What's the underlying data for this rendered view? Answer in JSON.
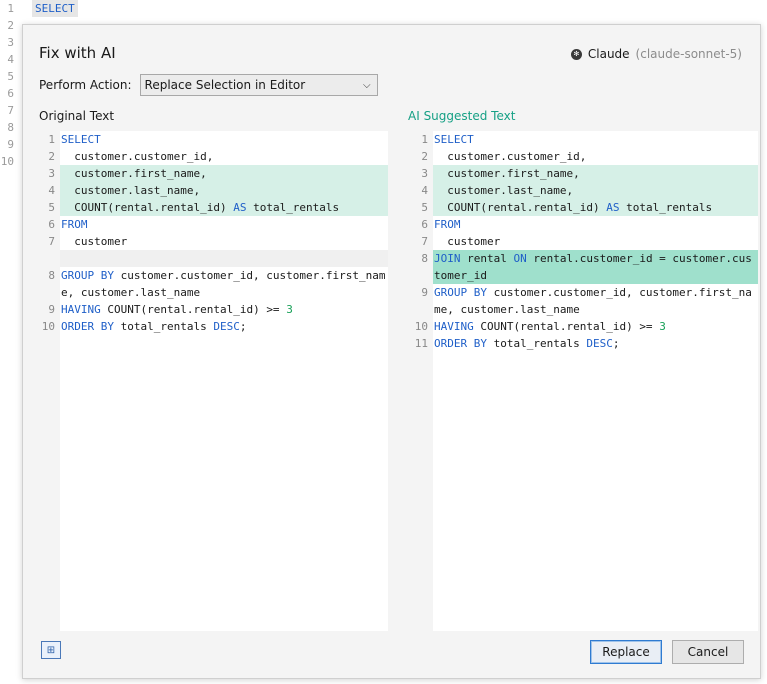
{
  "background_editor": {
    "line_numbers": [
      "1",
      "2",
      "3",
      "4",
      "5",
      "6",
      "7",
      "8",
      "9",
      "10"
    ],
    "first_line": "SELECT"
  },
  "dialog": {
    "title": "Fix with AI",
    "provider": {
      "icon": "claude-logo-icon",
      "name": "Claude",
      "model": "(claude-sonnet-5)"
    },
    "perform_action_label": "Perform Action:",
    "perform_action_value": "Replace Selection in Editor",
    "original_label": "Original Text",
    "ai_label": "AI Suggested Text",
    "replace_label": "Replace",
    "cancel_label": "Cancel",
    "toggle_icon": "diff-view-icon",
    "colors": {
      "highlight": "#d6f0e7",
      "highlight_strong": "#9fe0cc",
      "ai_label": "#16a085",
      "keyword": "#1f5fc8",
      "number": "#18a058"
    }
  },
  "original_lines": [
    {
      "n": "1",
      "hl": "",
      "tokens": [
        [
          "kw",
          "SELECT"
        ]
      ]
    },
    {
      "n": "2",
      "hl": "",
      "tokens": [
        [
          "",
          "  customer.customer_id,"
        ]
      ]
    },
    {
      "n": "3",
      "hl": "hl",
      "tokens": [
        [
          "",
          "  customer.first_name,"
        ]
      ]
    },
    {
      "n": "4",
      "hl": "hl",
      "tokens": [
        [
          "",
          "  customer.last_name,"
        ]
      ]
    },
    {
      "n": "5",
      "hl": "hl",
      "tokens": [
        [
          "",
          "  COUNT(rental.rental_id) "
        ],
        [
          "kw",
          "AS"
        ],
        [
          "",
          " total_rentals"
        ]
      ]
    },
    {
      "n": "6",
      "hl": "",
      "tokens": [
        [
          "kw",
          "FROM"
        ]
      ]
    },
    {
      "n": "7",
      "hl": "",
      "tokens": [
        [
          "",
          "  customer"
        ]
      ]
    },
    {
      "n": "",
      "hl": "spacer",
      "tokens": [
        [
          "",
          ""
        ]
      ]
    },
    {
      "n": "8",
      "hl": "",
      "tokens": [
        [
          "kw",
          "GROUP BY"
        ],
        [
          "",
          " customer.customer_id, customer.first_name, customer.last_name"
        ]
      ]
    },
    {
      "n": "9",
      "hl": "",
      "tokens": [
        [
          "kw",
          "HAVING"
        ],
        [
          "",
          " COUNT(rental.rental_id) >= "
        ],
        [
          "num",
          "3"
        ]
      ]
    },
    {
      "n": "10",
      "hl": "",
      "tokens": [
        [
          "kw",
          "ORDER BY"
        ],
        [
          "",
          " total_rentals "
        ],
        [
          "kw",
          "DESC"
        ],
        [
          "",
          ";"
        ]
      ]
    }
  ],
  "ai_lines": [
    {
      "n": "1",
      "hl": "",
      "tokens": [
        [
          "kw",
          "SELECT"
        ]
      ]
    },
    {
      "n": "2",
      "hl": "",
      "tokens": [
        [
          "",
          "  customer.customer_id,"
        ]
      ]
    },
    {
      "n": "3",
      "hl": "hl",
      "tokens": [
        [
          "",
          "  customer.first_name,"
        ]
      ]
    },
    {
      "n": "4",
      "hl": "hl",
      "tokens": [
        [
          "",
          "  customer.last_name,"
        ]
      ]
    },
    {
      "n": "5",
      "hl": "hl",
      "tokens": [
        [
          "",
          "  COUNT(rental.rental_id) "
        ],
        [
          "kw",
          "AS"
        ],
        [
          "",
          " total_rentals"
        ]
      ]
    },
    {
      "n": "6",
      "hl": "",
      "tokens": [
        [
          "kw",
          "FROM"
        ]
      ]
    },
    {
      "n": "7",
      "hl": "",
      "tokens": [
        [
          "",
          "  customer"
        ]
      ]
    },
    {
      "n": "8",
      "hl": "hl-strong",
      "tokens": [
        [
          "kw",
          "JOIN"
        ],
        [
          "",
          " rental "
        ],
        [
          "kw",
          "ON"
        ],
        [
          "",
          " rental.customer_id = customer.customer_id"
        ]
      ]
    },
    {
      "n": "9",
      "hl": "",
      "tokens": [
        [
          "kw",
          "GROUP BY"
        ],
        [
          "",
          " customer.customer_id, customer.first_name, customer.last_name"
        ]
      ]
    },
    {
      "n": "10",
      "hl": "",
      "tokens": [
        [
          "kw",
          "HAVING"
        ],
        [
          "",
          " COUNT(rental.rental_id) >= "
        ],
        [
          "num",
          "3"
        ]
      ]
    },
    {
      "n": "11",
      "hl": "",
      "tokens": [
        [
          "kw",
          "ORDER BY"
        ],
        [
          "",
          " total_rentals "
        ],
        [
          "kw",
          "DESC"
        ],
        [
          "",
          ";"
        ]
      ]
    }
  ]
}
